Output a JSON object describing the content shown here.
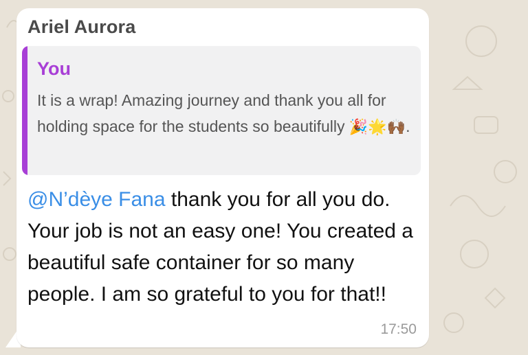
{
  "message": {
    "sender": "Ariel Aurora",
    "quote": {
      "author": "You",
      "text_before_emoji": "It is a wrap! Amazing journey and thank you all for holding space for the students so beautifully ",
      "emoji": "🎉🌟🙌🏾",
      "text_after_emoji": "."
    },
    "mention": "@N’dèye Fana",
    "body": " thank you for all you do. Your job is not an easy one! You created a beautiful safe container for so many people. I am so grateful to you for that!!",
    "time": "17:50"
  },
  "colors": {
    "bubble": "#ffffff",
    "quote_accent": "#a83fd6",
    "mention": "#3a8ee6",
    "wallpaper": "#e9e3d8"
  }
}
